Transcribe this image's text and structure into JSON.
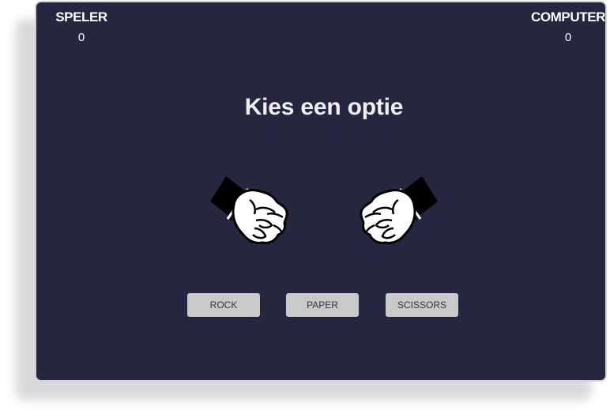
{
  "scoreboard": {
    "player_label": "SPELER",
    "player_score": "0",
    "computer_label": "COMPUTER",
    "computer_score": "0"
  },
  "prompt": "Kies een optie",
  "hands": {
    "player_icon": "fist-icon",
    "computer_icon": "fist-icon"
  },
  "choices": {
    "rock_label": "ROCK",
    "paper_label": "PAPER",
    "scissors_label": "SCISSORS"
  },
  "colors": {
    "panel_background": "#262640",
    "button_background": "#c9c9c9",
    "text": "#ffffff"
  }
}
